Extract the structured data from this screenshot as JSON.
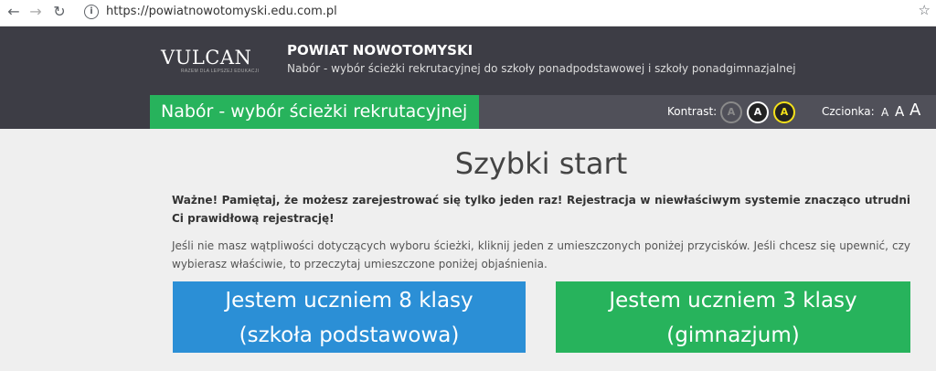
{
  "browser": {
    "url": "https://powiatnowotomyski.edu.com.pl",
    "back_glyph": "←",
    "forward_glyph": "→",
    "reload_glyph": "↻",
    "info_glyph": "i",
    "star_glyph": "☆"
  },
  "header": {
    "logo": "VULCAN",
    "logo_tagline": "RAZEM DLA LEPSZEJ EDUKACJI",
    "org_title": "POWIAT NOWOTOMYSKI",
    "org_subtitle": "Nabór - wybór ścieżki rekrutacyjnej do szkoły ponadpodstawowej i szkoły ponadgimnazjalnej"
  },
  "subbar": {
    "page_title": "Nabór - wybór ścieżki rekrutacyjnej",
    "kontrast_label": "Kontrast:",
    "kontrast_options": [
      "A",
      "A",
      "A"
    ],
    "font_label": "Czcionka:",
    "font_options": [
      "A",
      "A",
      "A"
    ]
  },
  "main": {
    "title": "Szybki start",
    "warning": "Ważne! Pamiętaj, że możesz zarejestrować się tylko jeden raz! Rejestracja w niewłaściwym systemie znacząco utrudni Ci prawidłową rejestrację!",
    "info": "Jeśli nie masz wątpliwości dotyczących wyboru ścieżki, kliknij jeden z umieszczonych poniżej przycisków. Jeśli chcesz się upewnić, czy wybierasz właściwie, to przeczytaj umieszczone poniżej objaśnienia.",
    "btn_primary_line1": "Jestem uczniem 8 klasy",
    "btn_primary_line2": "(szkoła podstawowa)",
    "btn_secondary_line1": "Jestem uczniem 3 klasy",
    "btn_secondary_line2": "(gimnazjum)"
  },
  "colors": {
    "header_bg": "#3d3d45",
    "green": "#27b35c",
    "blue": "#2b8fd6",
    "contrast_yellow": "#f5e11a"
  }
}
